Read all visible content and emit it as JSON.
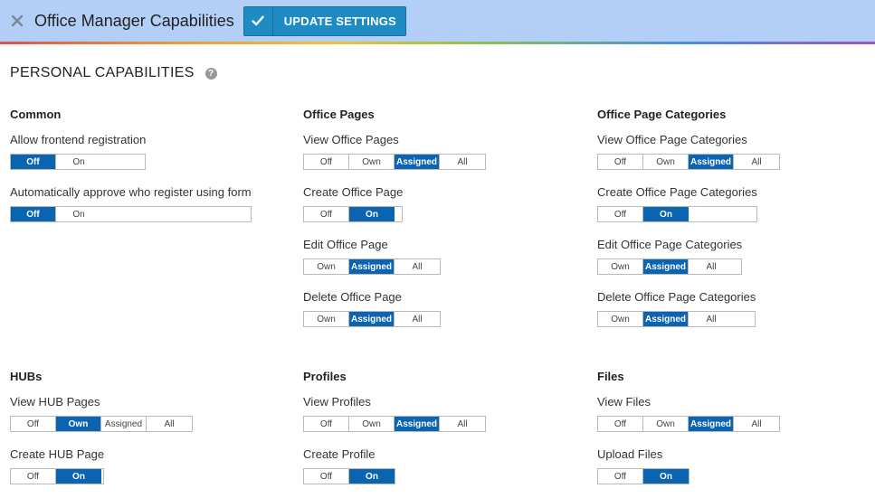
{
  "header": {
    "title": "Office Manager Capabilities",
    "update_label": "UPDATE SETTINGS"
  },
  "section": {
    "heading": "PERSONAL CAPABILITIES",
    "help_glyph": "?"
  },
  "groups": {
    "common": {
      "title": "Common",
      "caps": [
        {
          "label": "Allow frontend registration",
          "options": [
            "Off",
            "On"
          ],
          "selected": "Off"
        },
        {
          "label": "Automatically approve who register using form",
          "options": [
            "Off",
            "On"
          ],
          "selected": "Off"
        }
      ]
    },
    "office_pages": {
      "title": "Office Pages",
      "caps": [
        {
          "label": "View Office Pages",
          "options": [
            "Off",
            "Own",
            "Assigned",
            "All"
          ],
          "selected": "Assigned"
        },
        {
          "label": "Create Office Page",
          "options": [
            "Off",
            "On"
          ],
          "selected": "On"
        },
        {
          "label": "Edit Office Page",
          "options": [
            "Own",
            "Assigned",
            "All"
          ],
          "selected": "Assigned"
        },
        {
          "label": "Delete Office Page",
          "options": [
            "Own",
            "Assigned",
            "All"
          ],
          "selected": "Assigned"
        }
      ]
    },
    "office_page_categories": {
      "title": "Office Page Categories",
      "caps": [
        {
          "label": "View Office Page Categories",
          "options": [
            "Off",
            "Own",
            "Assigned",
            "All"
          ],
          "selected": "Assigned"
        },
        {
          "label": "Create Office Page Categories",
          "options": [
            "Off",
            "On"
          ],
          "selected": "On"
        },
        {
          "label": "Edit Office Page Categories",
          "options": [
            "Own",
            "Assigned",
            "All"
          ],
          "selected": "Assigned"
        },
        {
          "label": "Delete Office Page Categories",
          "options": [
            "Own",
            "Assigned",
            "All"
          ],
          "selected": "Assigned"
        }
      ]
    },
    "hubs": {
      "title": "HUBs",
      "caps": [
        {
          "label": "View HUB Pages",
          "options": [
            "Off",
            "Own",
            "Assigned",
            "All"
          ],
          "selected": "Own"
        },
        {
          "label": "Create HUB Page",
          "options": [
            "Off",
            "On"
          ],
          "selected": "On"
        }
      ]
    },
    "profiles": {
      "title": "Profiles",
      "caps": [
        {
          "label": "View Profiles",
          "options": [
            "Off",
            "Own",
            "Assigned",
            "All"
          ],
          "selected": "Assigned"
        },
        {
          "label": "Create Profile",
          "options": [
            "Off",
            "On"
          ],
          "selected": "On"
        }
      ]
    },
    "files": {
      "title": "Files",
      "caps": [
        {
          "label": "View Files",
          "options": [
            "Off",
            "Own",
            "Assigned",
            "All"
          ],
          "selected": "Assigned"
        },
        {
          "label": "Upload Files",
          "options": [
            "Off",
            "On"
          ],
          "selected": "On"
        }
      ]
    }
  },
  "colors": {
    "header_bg": "#b3cff7",
    "button_bg": "#1e8bc3",
    "selected_bg": "#0a64b0"
  }
}
